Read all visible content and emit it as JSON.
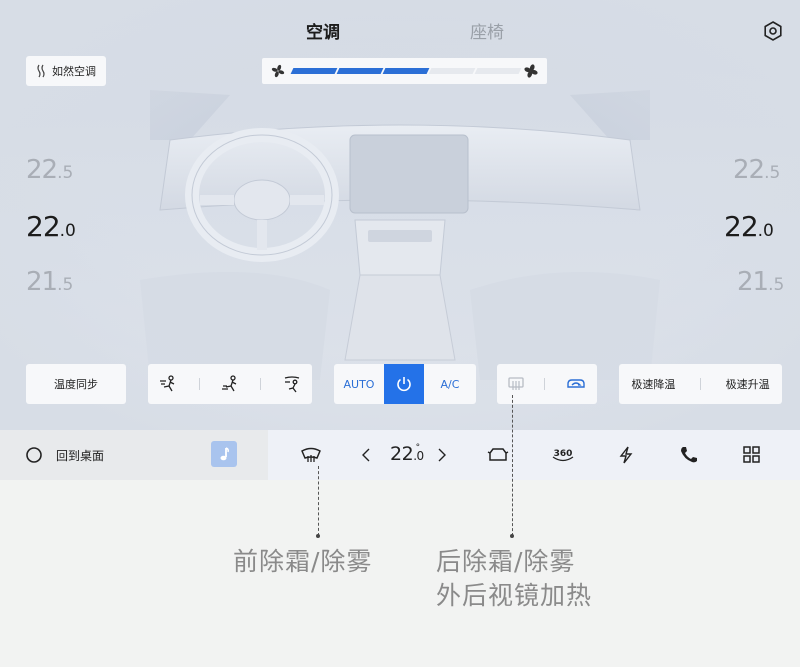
{
  "tabs": [
    {
      "label": "空调",
      "active": true
    },
    {
      "label": "座椅",
      "active": false
    }
  ],
  "header": {
    "settings_icon": "gear-icon"
  },
  "natural_ac": {
    "label": "如然空调",
    "icon": "wind-icon"
  },
  "fan": {
    "level": 3,
    "max": 5,
    "accent": "#2b6fd6"
  },
  "left_temp": {
    "upper": {
      "int": "22",
      "dec": ".5"
    },
    "current": {
      "int": "22",
      "dec": ".0"
    },
    "lower": {
      "int": "21",
      "dec": ".5"
    }
  },
  "right_temp": {
    "upper": {
      "int": "22",
      "dec": ".5"
    },
    "current": {
      "int": "22",
      "dec": ".0"
    },
    "lower": {
      "int": "21",
      "dec": ".5"
    }
  },
  "controls": {
    "sync_label": "温度同步",
    "mode_icons": [
      "face-airflow-icon",
      "foot-airflow-icon",
      "windshield-airflow-icon"
    ],
    "auto_label": "AUTO",
    "power_icon": "power-icon",
    "ac_label": "A/C",
    "rear_defrost_icon": "rear-defrost-icon",
    "recirculation_icon": "recirculation-icon",
    "fast_cool_label": "极速降温",
    "fast_heat_label": "极速升温"
  },
  "bottom_bar": {
    "home_label": "回到桌面",
    "temp_int": "22",
    "temp_dec": ".0",
    "temp_deg": "°"
  },
  "annotations": {
    "front": "前除霜/除雾",
    "rear_line1": "后除霜/除雾",
    "rear_line2": "外后视镜加热"
  }
}
